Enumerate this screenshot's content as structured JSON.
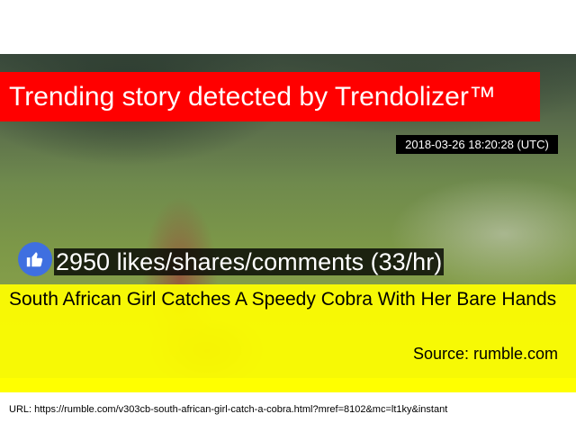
{
  "banner": {
    "title": "Trending story detected by Trendolizer™"
  },
  "timestamp": "2018-03-26 18:20:28 (UTC)",
  "engagement": {
    "icon": "thumbs-up-icon",
    "text": "2950 likes/shares/comments (33/hr)"
  },
  "story": {
    "headline": "South African Girl Catches A Speedy Cobra With Her Bare Hands",
    "source": "Source: rumble.com"
  },
  "url_line": "URL: https://rumble.com/v303cb-south-african-girl-catch-a-cobra.html?mref=8102&mc=lt1ky&instant",
  "colors": {
    "banner_red": "#ff0000",
    "panel_yellow": "#ffff00",
    "like_blue": "#3f6fe0"
  }
}
